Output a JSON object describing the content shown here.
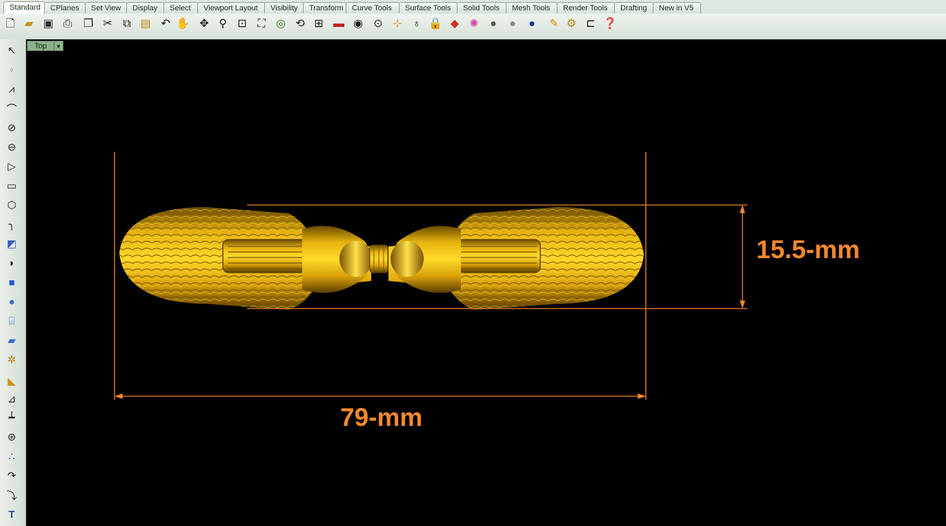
{
  "tabs": [
    "Standard",
    "CPlanes",
    "Set View",
    "Display",
    "Select",
    "Viewport Layout",
    "Visibility",
    "Transform",
    "Curve Tools",
    "Surface Tools",
    "Solid Tools",
    "Mesh Tools",
    "Render Tools",
    "Drafting",
    "New in V5"
  ],
  "viewport": {
    "name": "Top"
  },
  "dimensions": {
    "height_label": "15.5-mm",
    "width_label": "79-mm"
  },
  "colors": {
    "dimension": "#f6892a",
    "model_gold": "#e6b800",
    "viewport_bg": "#000000"
  },
  "toolbar_icons": [
    "new-file-icon",
    "open-folder-icon",
    "save-icon",
    "print-icon",
    "paste-template-icon",
    "cut-icon",
    "copy-icon",
    "paste-icon",
    "undo-icon",
    "pan-hand-icon",
    "rotate-view-icon",
    "zoom-icon",
    "zoom-window-icon",
    "zoom-extents-icon",
    "zoom-selected-icon",
    "undo-view-icon",
    "four-viewports-icon",
    "car-properties-icon",
    "visibility-eye-icon",
    "cplane-icon",
    "snap-icon",
    "light-bulb-icon",
    "lock-icon",
    "layer-icon",
    "color-wheel-icon",
    "shaded-sphere-icon",
    "rendered-sphere-icon",
    "blue-sphere-icon",
    "pencil-options-icon",
    "gear-settings-icon",
    "grid-snap-icon",
    "help-icon"
  ],
  "left_icons": [
    "select-arrow-icon",
    "point-icon",
    "polyline-icon",
    "curve-icon",
    "circle-icon",
    "ellipse-icon",
    "polygon-icon",
    "rectangle-icon",
    "hexagon-icon",
    "fillet-curve-icon",
    "surface-from-points-icon",
    "extrude-icon",
    "box-icon",
    "sphere-icon",
    "cylinder-icon",
    "plane-surface-icon",
    "solid-tools-icon",
    "transform-icon",
    "edit-points-icon",
    "dimension-icon",
    "boolean-icon",
    "points-group-icon",
    "curve-edit-icon",
    "curve-offset-icon",
    "text-icon"
  ]
}
